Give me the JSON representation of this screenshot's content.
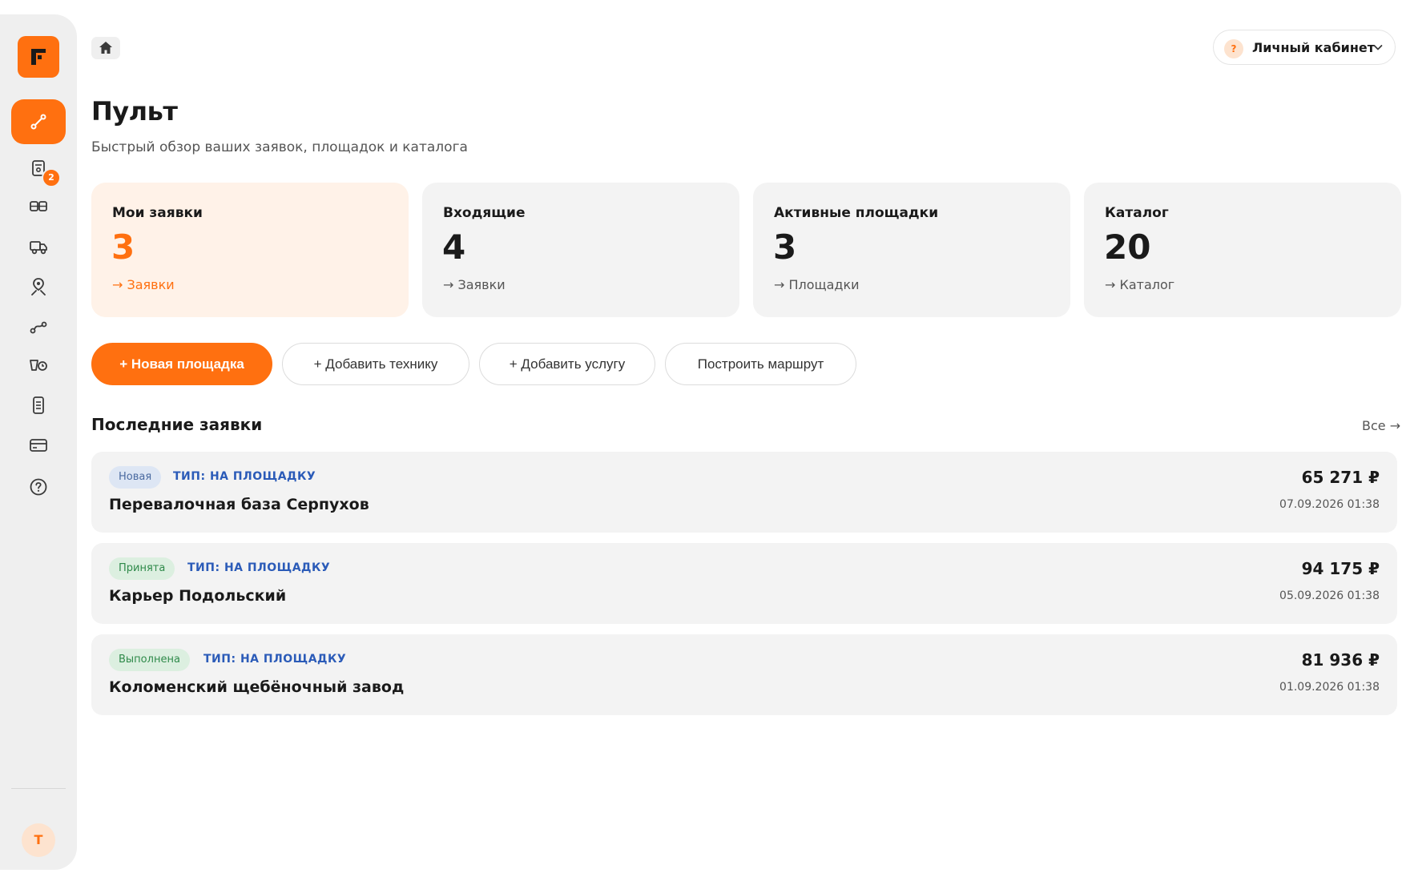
{
  "sidebar": {
    "badge_count": "2",
    "avatar_initial": "Т",
    "items": [
      {
        "icon": "route-icon",
        "active": true
      },
      {
        "icon": "orders-icon",
        "active": false
      },
      {
        "icon": "platforms-icon",
        "active": false
      },
      {
        "icon": "truck-icon",
        "active": false
      },
      {
        "icon": "location-icon",
        "active": false
      },
      {
        "icon": "path-icon",
        "active": false
      },
      {
        "icon": "schedule-icon",
        "active": false
      },
      {
        "icon": "document-icon",
        "active": false
      },
      {
        "icon": "payment-card-icon",
        "active": false
      },
      {
        "icon": "help-icon",
        "active": false
      }
    ]
  },
  "header": {
    "account_label": "Личный кабинет",
    "help_mark": "?"
  },
  "page": {
    "title": "Пульт",
    "subtitle": "Быстрый обзор ваших заявок, площадок и каталога"
  },
  "stats": [
    {
      "label": "Мои заявки",
      "value": "3",
      "link": "→ Заявки"
    },
    {
      "label": "Входящие",
      "value": "4",
      "link": "→ Заявки"
    },
    {
      "label": "Активные площадки",
      "value": "3",
      "link": "→ Площадки"
    },
    {
      "label": "Каталог",
      "value": "20",
      "link": "→ Каталог"
    }
  ],
  "actions": {
    "new_platform": "+ Новая площадка",
    "add_equipment": "+ Добавить технику",
    "add_service": "+ Добавить услугу",
    "build_route": "Построить маршрут"
  },
  "recent": {
    "title": "Последние заявки",
    "all_link": "Все →",
    "orders": [
      {
        "status": "Новая",
        "type": "ТИП: НА ПЛОЩАДКУ",
        "name": "Перевалочная база Серпухов",
        "price": "65 271 ₽",
        "date": "07.09.2026 01:38"
      },
      {
        "status": "Принята",
        "type": "ТИП: НА ПЛОЩАДКУ",
        "name": "Карьер Подольский",
        "price": "94 175 ₽",
        "date": "05.09.2026 01:38"
      },
      {
        "status": "Выполнена",
        "type": "ТИП: НА ПЛОЩАДКУ",
        "name": "Коломенский щебёночный завод",
        "price": "81 936 ₽",
        "date": "01.09.2026 01:38"
      }
    ]
  },
  "colors": {
    "accent": "#ff7010",
    "accent_soft": "#fff2e8",
    "card_bg": "#f3f3f3",
    "type_blue": "#2b5bb8",
    "status_new": "#4a6aa0",
    "status_done": "#2f8a4a"
  }
}
